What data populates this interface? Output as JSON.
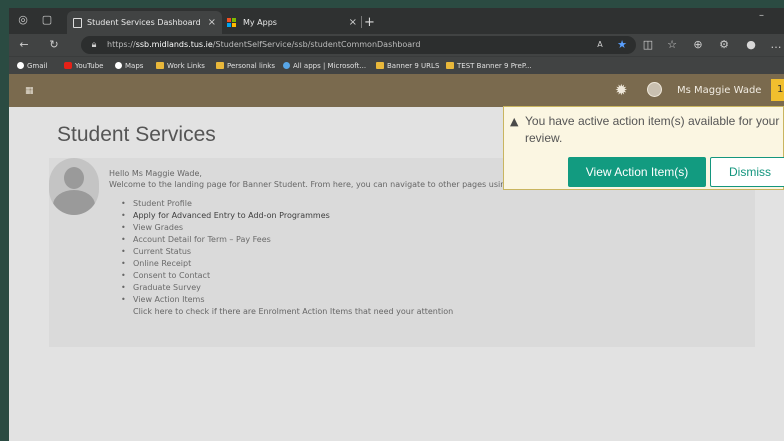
{
  "browser": {
    "tabs": [
      {
        "title": "Student Services Dashboard",
        "close": "×"
      },
      {
        "title": "My Apps",
        "close": "×"
      }
    ],
    "new_tab": "+",
    "minimize": "–",
    "url_prefix": "https://",
    "url_host": "ssb.midlands.tus.ie",
    "url_path": "/StudentSelfService/ssb/studentCommonDashboard",
    "bookmarks": [
      {
        "label": "Gmail",
        "icon": "gmail-icon"
      },
      {
        "label": "YouTube",
        "icon": "youtube-icon"
      },
      {
        "label": "Maps",
        "icon": "maps-icon"
      },
      {
        "label": "Work Links",
        "icon": "folder-icon"
      },
      {
        "label": "Personal links",
        "icon": "folder-icon"
      },
      {
        "label": "All apps | Microsoft...",
        "icon": "microsoft-icon"
      },
      {
        "label": "Banner 9 URLS",
        "icon": "folder-icon"
      },
      {
        "label": "TEST Banner 9 PreP...",
        "icon": "folder-icon"
      }
    ]
  },
  "header": {
    "user_name": "Ms Maggie Wade",
    "notification_count": "1"
  },
  "main": {
    "title": "Student Services",
    "greeting": "Hello Ms Maggie Wade,",
    "welcome": "Welcome to the landing page for Banner Student. From here, you can navigate to other pages using t",
    "links": [
      "Student Profile",
      "Apply for Advanced Entry to Add-on Programmes",
      "View Grades",
      "Account Detail for Term – Pay Fees",
      "Current Status",
      "Online Receipt",
      "Consent to Contact",
      "Graduate Survey",
      "View Action Items"
    ],
    "action_note": "Click here to check if there are Enrolment Action Items that need your attention"
  },
  "popup": {
    "message": "You have active action item(s) available for your review.",
    "primary_button": "View Action Item(s)",
    "secondary_button": "Dismiss"
  },
  "colors": {
    "header_bg": "#7a6a4e",
    "primary_button": "#129b80",
    "notification": "#f1bf2e"
  }
}
